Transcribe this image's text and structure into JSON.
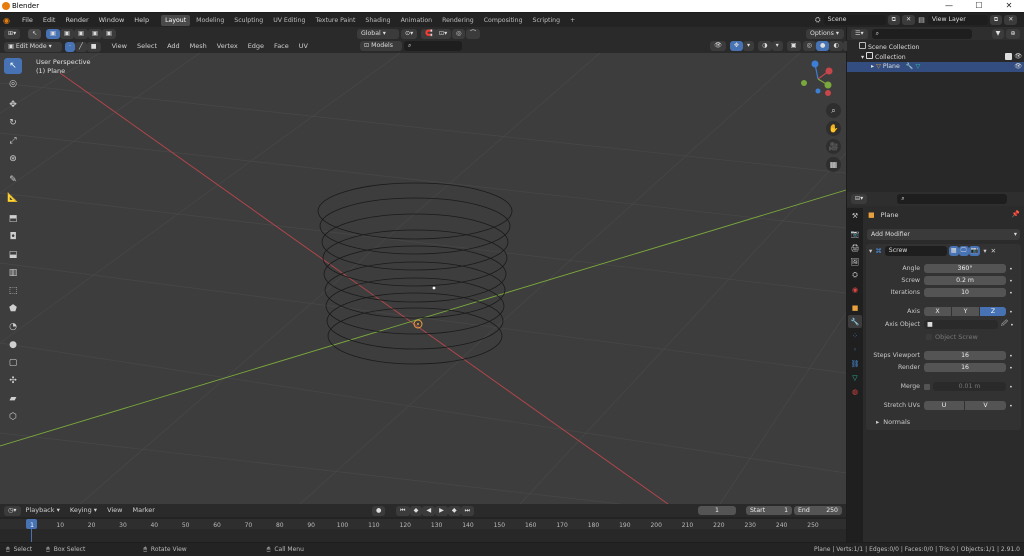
{
  "window": {
    "title": "Blender",
    "controls": [
      "—",
      "☐",
      "✕"
    ]
  },
  "menu": [
    "File",
    "Edit",
    "Render",
    "Window",
    "Help"
  ],
  "workspaces": [
    "Layout",
    "Modeling",
    "Sculpting",
    "UV Editing",
    "Texture Paint",
    "Shading",
    "Animation",
    "Rendering",
    "Compositing",
    "Scripting"
  ],
  "active_workspace": "Layout",
  "scene": {
    "name": "Scene",
    "view_layer": "View Layer"
  },
  "vp_header": {
    "mode": "Edit Mode",
    "menus": [
      "View",
      "Select",
      "Add",
      "Mesh",
      "Vertex",
      "Edge",
      "Face",
      "UV"
    ],
    "orientation": "Global",
    "options": "Options",
    "snap_target": "Models"
  },
  "viewport": {
    "perspective": "User Perspective",
    "object": "(1) Plane"
  },
  "outliner": {
    "root": "Scene Collection",
    "collection": "Collection",
    "object": "Plane"
  },
  "properties": {
    "object_name": "Plane",
    "add_modifier": "Add Modifier",
    "modifier_name": "Screw",
    "fields": [
      {
        "label": "Angle",
        "value": "360°"
      },
      {
        "label": "Screw",
        "value": "0.2 m"
      },
      {
        "label": "Iterations",
        "value": "10"
      }
    ],
    "axis_label": "Axis",
    "axis_options": [
      "X",
      "Y",
      "Z"
    ],
    "axis_active": "Z",
    "axis_object_label": "Axis Object",
    "object_screw": "Object Screw",
    "steps_viewport_label": "Steps Viewport",
    "steps_viewport": "16",
    "render_label": "Render",
    "render_steps": "16",
    "merge_label": "Merge",
    "merge_value": "0.01 m",
    "stretch_label": "Stretch UVs",
    "stretch_u": "U",
    "stretch_v": "V",
    "normals": "Normals"
  },
  "timeline": {
    "menus": [
      "Playback",
      "Keying",
      "View",
      "Marker"
    ],
    "current": "1",
    "start_label": "Start",
    "start": "1",
    "end_label": "End",
    "end": "250",
    "ticks": [
      "1",
      "10",
      "20",
      "30",
      "40",
      "50",
      "60",
      "70",
      "80",
      "90",
      "100",
      "110",
      "120",
      "130",
      "140",
      "150",
      "160",
      "170",
      "180",
      "190",
      "200",
      "210",
      "220",
      "230",
      "240",
      "250"
    ]
  },
  "status": {
    "select": "Select",
    "box_select": "Box Select",
    "rotate": "Rotate View",
    "call_menu": "Call Menu",
    "stats": "Plane | Verts:1/1 | Edges:0/0 | Faces:0/0 | Tris:0 | Objects:1/1 | 2.91.0"
  },
  "colors": {
    "accent": "#4772b3",
    "x_axis": "#c8454a",
    "y_axis": "#7aa83c",
    "z_axis": "#3e7fd6"
  }
}
